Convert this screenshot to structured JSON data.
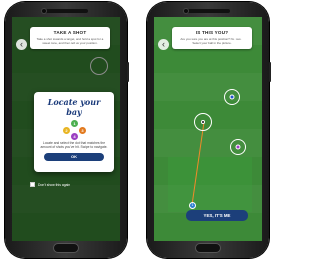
{
  "left_screen": {
    "tip": {
      "title": "TAKE A SHOT",
      "body": "Take a shot towards a target, and hold a spot for a sweet tone, and then tell us your position."
    },
    "modal": {
      "title": "Locate your bay",
      "dots": [
        "1",
        "2",
        "3",
        "4"
      ],
      "body": "Locate and select the dot that matches the amount of shots you've hit. Swipe to navigate.",
      "ok_label": "OK"
    },
    "dont_show_label": "Don't show this again",
    "back_icon": "chevron-left-icon"
  },
  "right_screen": {
    "tip": {
      "title": "IS THIS YOU?",
      "body": "Are you sure you are at this position? Not sure? Select your ball in the picture."
    },
    "ball_label": "1",
    "confirm_label": "YES, IT'S ME",
    "back_icon": "chevron-left-icon"
  },
  "colors": {
    "grass": "#3d8a38",
    "navy": "#1c3f7a",
    "dot_yellow": "#e8b523",
    "dot_green": "#4caf50",
    "dot_blue": "#2255cc",
    "dot_purple": "#9b3fc2",
    "dot_orange": "#e27a1f",
    "aim_line": "#f08a2a"
  }
}
